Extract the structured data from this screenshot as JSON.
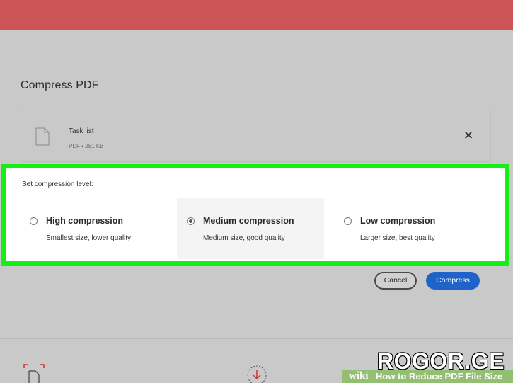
{
  "page": {
    "title": "Compress PDF"
  },
  "file": {
    "name": "Task list",
    "meta": "PDF • 281 KB"
  },
  "compression": {
    "label": "Set compression level:",
    "selected": "medium",
    "options": [
      {
        "id": "high",
        "title": "High compression",
        "description": "Smallest size, lower quality"
      },
      {
        "id": "medium",
        "title": "Medium compression",
        "description": "Medium size, good quality"
      },
      {
        "id": "low",
        "title": "Low compression",
        "description": "Larger size, best quality"
      }
    ]
  },
  "actions": {
    "cancel_label": "Cancel",
    "compress_label": "Compress"
  },
  "watermark": {
    "site": "ROGOR.GE",
    "wiki": "wiki",
    "caption": "How to Reduce PDF File Size"
  },
  "colors": {
    "header": "#cc5456",
    "highlight_border": "#14f014",
    "primary_button": "#1f63c9",
    "tool_accent": "#d0312d"
  },
  "icons": {
    "file": "file-icon",
    "close": "close-icon",
    "crop_tool": "crop-document-icon",
    "download_tool": "download-icon"
  }
}
